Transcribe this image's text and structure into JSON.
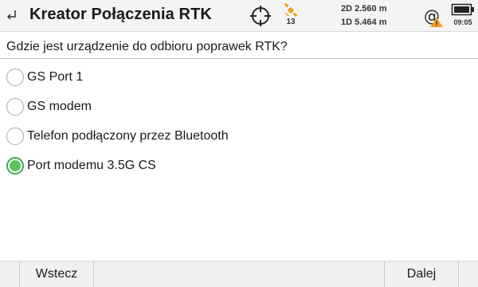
{
  "header": {
    "back_icon": "return-arrow-icon",
    "title": "Kreator Połączenia RTK",
    "target_icon": "crosshair-target-icon",
    "satellite_icon": "satellite-icon",
    "satellite_count": "13",
    "precision_2d": "2D 2.560 m",
    "precision_1d": "1D 5.464 m",
    "link_icon": "at-link-warning-icon",
    "battery_icon": "battery-icon",
    "time": "09:05",
    "colors": {
      "satellite": "#f0a020",
      "warning": "#f0a020"
    }
  },
  "question": "Gdzie jest urządzenie do odbioru poprawek RTK?",
  "options": [
    {
      "label": "GS Port 1",
      "selected": false
    },
    {
      "label": "GS modem",
      "selected": false
    },
    {
      "label": "Telefon podłączony przez Bluetooth",
      "selected": false
    },
    {
      "label": "Port modemu 3.5G CS",
      "selected": true
    }
  ],
  "footer": {
    "back_label": "Wstecz",
    "next_label": "Dalej"
  },
  "colors": {
    "selected_radio": "#5cc15a"
  }
}
